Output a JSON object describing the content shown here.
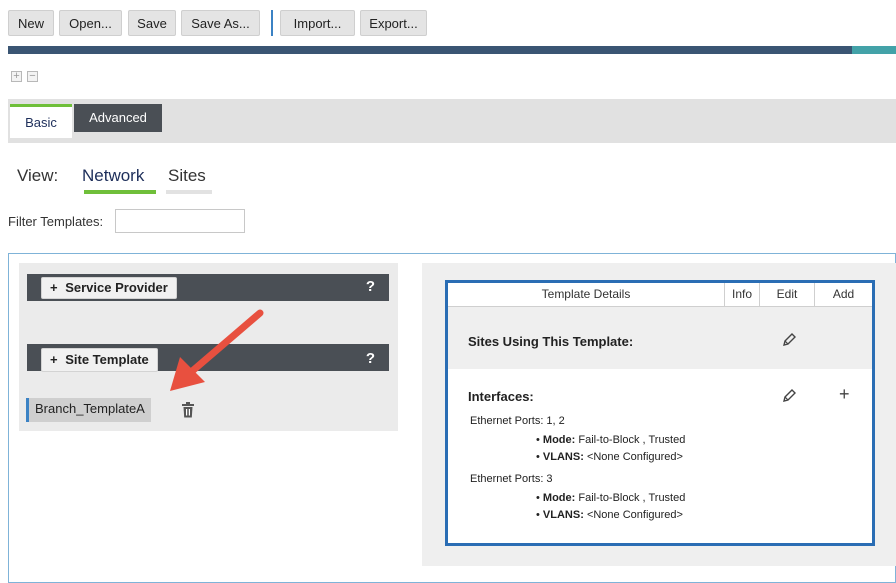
{
  "toolbar": {
    "new": "New",
    "open": "Open...",
    "save": "Save",
    "save_as": "Save As...",
    "import": "Import...",
    "export": "Export..."
  },
  "controls": {
    "expand": "+",
    "collapse": "−"
  },
  "tabs": {
    "basic": "Basic",
    "advanced": "Advanced"
  },
  "view": {
    "label": "View:",
    "network": "Network",
    "sites": "Sites"
  },
  "filter": {
    "label": "Filter Templates:",
    "value": ""
  },
  "left": {
    "service_provider": "Service Provider",
    "site_template": "Site Template",
    "help": "?",
    "plus": "+",
    "template_item": "Branch_TemplateA"
  },
  "details": {
    "header": "Template Details",
    "info": "Info",
    "edit": "Edit",
    "add": "Add",
    "sites_title": "Sites Using This Template:",
    "interfaces_title": "Interfaces:",
    "add_symbol": "+",
    "ports": [
      {
        "label": "Ethernet Ports: 1, 2",
        "mode_label": "Mode:",
        "mode_value": "Fail-to-Block , Trusted",
        "vlans_label": "VLANS:",
        "vlans_value": "<None Configured>"
      },
      {
        "label": "Ethernet Ports: 3",
        "mode_label": "Mode:",
        "mode_value": "Fail-to-Block , Trusted",
        "vlans_label": "VLANS:",
        "vlans_value": "<None Configured>"
      }
    ]
  },
  "colors": {
    "accent_green": "#6fbf3a",
    "accent_blue": "#2a6db4",
    "dark_bar": "#4a4f55",
    "arrow": "#e8503f"
  },
  "icons": [
    "plus-box-icon",
    "minus-box-icon",
    "trash-icon",
    "pencil-icon",
    "add-icon",
    "arrow-annotation"
  ]
}
